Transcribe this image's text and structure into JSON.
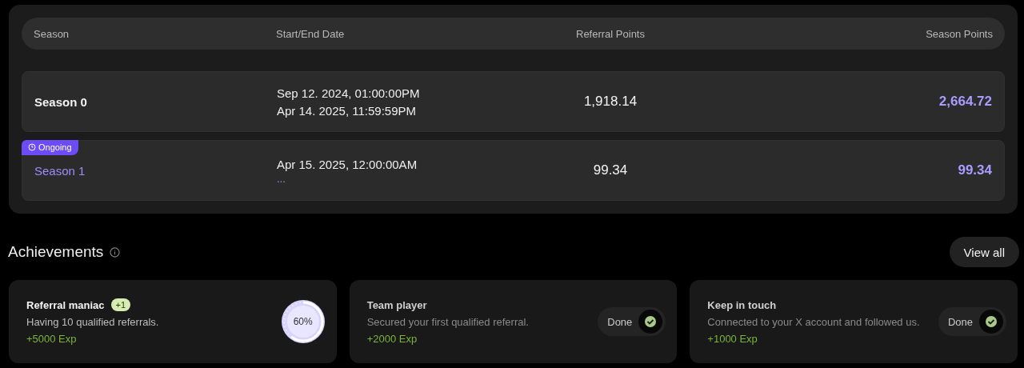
{
  "seasons_table": {
    "columns": [
      "Season",
      "Start/End Date",
      "Referral Points",
      "Season Points"
    ],
    "rows": [
      {
        "season": "Season 0",
        "ongoing": false,
        "dates": [
          "Sep 12. 2024, 01:00:00PM",
          "Apr 14. 2025, 11:59:59PM"
        ],
        "referral_points": "1,918.14",
        "season_points": "2,664.72"
      },
      {
        "season": "Season 1",
        "ongoing": true,
        "badge": "Ongoing",
        "dates": [
          "Apr 15. 2025, 12:00:00AM",
          "..."
        ],
        "referral_points": "99.34",
        "season_points": "99.34"
      }
    ]
  },
  "achievements": {
    "title": "Achievements",
    "view_all": "View all",
    "cards": [
      {
        "kind": "progress",
        "title": "Referral maniac",
        "badge": "+1",
        "description": "Having 10 qualified referrals.",
        "reward": "+5000 Exp",
        "reading": "60%"
      },
      {
        "kind": "done",
        "title": "Team player",
        "description": "Secured your first qualified referral.",
        "reward": "+2000 Exp",
        "status": "Done"
      },
      {
        "kind": "done",
        "title": "Keep in touch",
        "description": "Connected to your X account and followed us.",
        "reward": "+1000 Exp",
        "status": "Done"
      }
    ]
  }
}
